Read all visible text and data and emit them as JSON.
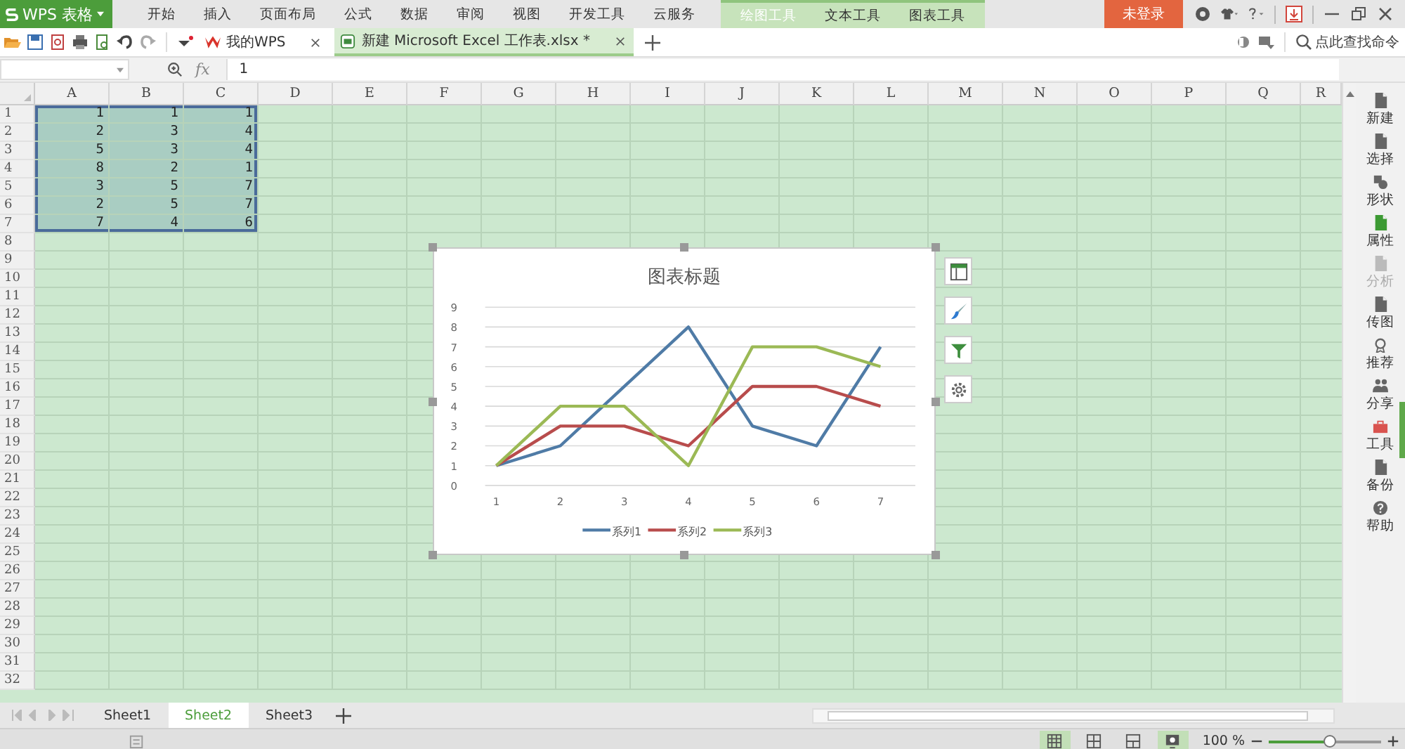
{
  "app": {
    "logo": "WPS 表格"
  },
  "menu_tabs": [
    {
      "label": "开始",
      "selected": false
    },
    {
      "label": "插入",
      "selected": false
    },
    {
      "label": "页面布局",
      "selected": false
    },
    {
      "label": "公式",
      "selected": false
    },
    {
      "label": "数据",
      "selected": false
    },
    {
      "label": "审阅",
      "selected": false
    },
    {
      "label": "视图",
      "selected": false
    },
    {
      "label": "开发工具",
      "selected": false
    },
    {
      "label": "云服务",
      "selected": false
    }
  ],
  "context_tabs": [
    {
      "label": "绘图工具",
      "selected": true
    },
    {
      "label": "文本工具",
      "selected": false
    },
    {
      "label": "图表工具",
      "selected": false
    }
  ],
  "login_button": "未登录",
  "doc_tabs": [
    {
      "label": "我的WPS",
      "selected": false
    },
    {
      "label": "新建 Microsoft Excel 工作表.xlsx *",
      "selected": true
    }
  ],
  "command_search": {
    "placeholder": "点此查找命令"
  },
  "formula_bar": {
    "fx": "fx",
    "value": "1"
  },
  "columns": [
    "A",
    "B",
    "C",
    "D",
    "E",
    "F",
    "G",
    "H",
    "I",
    "J",
    "K",
    "L",
    "M",
    "N",
    "O",
    "P",
    "Q",
    "R"
  ],
  "rows": [
    {
      "label": "1",
      "cells": [
        {
          "value": "1",
          "selected": true
        },
        {
          "value": "1",
          "selected": true
        },
        {
          "value": "1",
          "selected": true
        }
      ]
    },
    {
      "label": "2",
      "cells": [
        {
          "value": "2",
          "selected": true
        },
        {
          "value": "3",
          "selected": true
        },
        {
          "value": "4",
          "selected": true
        }
      ]
    },
    {
      "label": "3",
      "cells": [
        {
          "value": "5",
          "selected": true
        },
        {
          "value": "3",
          "selected": true
        },
        {
          "value": "4",
          "selected": true
        }
      ]
    },
    {
      "label": "4",
      "cells": [
        {
          "value": "8",
          "selected": true
        },
        {
          "value": "2",
          "selected": true
        },
        {
          "value": "1",
          "selected": true
        }
      ]
    },
    {
      "label": "5",
      "cells": [
        {
          "value": "3",
          "selected": true
        },
        {
          "value": "5",
          "selected": true
        },
        {
          "value": "7",
          "selected": true
        }
      ]
    },
    {
      "label": "6",
      "cells": [
        {
          "value": "2",
          "selected": true
        },
        {
          "value": "5",
          "selected": true
        },
        {
          "value": "7",
          "selected": true
        }
      ]
    },
    {
      "label": "7",
      "cells": [
        {
          "value": "7",
          "selected": true
        },
        {
          "value": "4",
          "selected": true
        },
        {
          "value": "6",
          "selected": true
        }
      ]
    },
    {
      "label": "8"
    },
    {
      "label": "9"
    },
    {
      "label": "10"
    },
    {
      "label": "11"
    },
    {
      "label": "12"
    },
    {
      "label": "13"
    },
    {
      "label": "14"
    },
    {
      "label": "15"
    },
    {
      "label": "16"
    },
    {
      "label": "17"
    },
    {
      "label": "18"
    },
    {
      "label": "19"
    },
    {
      "label": "20"
    },
    {
      "label": "21"
    },
    {
      "label": "22"
    },
    {
      "label": "23"
    },
    {
      "label": "24"
    },
    {
      "label": "25"
    },
    {
      "label": "26"
    },
    {
      "label": "27"
    },
    {
      "label": "28"
    },
    {
      "label": "29"
    },
    {
      "label": "30"
    },
    {
      "label": "31"
    },
    {
      "label": "32"
    }
  ],
  "chart": {
    "chart_data": {
      "type": "line",
      "title": "图表标题",
      "grid": true,
      "legend": true,
      "categories": [
        "1",
        "2",
        "3",
        "4",
        "5",
        "6",
        "7"
      ],
      "ylim": [
        0,
        9
      ],
      "yticks": [
        0,
        1,
        2,
        3,
        4,
        5,
        6,
        7,
        8,
        9
      ],
      "series": [
        {
          "name": "系列1",
          "color": "#4f7ba6",
          "values": [
            1,
            2,
            5,
            8,
            3,
            2,
            7
          ]
        },
        {
          "name": "系列2",
          "color": "#b84c4c",
          "values": [
            1,
            3,
            3,
            2,
            5,
            5,
            4
          ]
        },
        {
          "name": "系列3",
          "color": "#9bb955",
          "values": [
            1,
            4,
            4,
            1,
            7,
            7,
            6
          ]
        }
      ]
    }
  },
  "sidebar": [
    {
      "label": "新建",
      "disabled": false,
      "selected": false
    },
    {
      "label": "选择",
      "disabled": false,
      "selected": false
    },
    {
      "label": "形状",
      "disabled": false,
      "selected": false
    },
    {
      "label": "属性",
      "disabled": false,
      "selected": true
    },
    {
      "label": "分析",
      "disabled": true,
      "selected": false
    },
    {
      "label": "传图",
      "disabled": false,
      "selected": false
    },
    {
      "label": "推荐",
      "disabled": false,
      "selected": false
    },
    {
      "label": "分享",
      "disabled": false,
      "selected": false
    },
    {
      "label": "工具",
      "disabled": false,
      "selected": false
    },
    {
      "label": "备份",
      "disabled": false,
      "selected": false
    },
    {
      "label": "帮助",
      "disabled": false,
      "selected": false
    }
  ],
  "sheet_tabs": [
    {
      "label": "Sheet1",
      "selected": false
    },
    {
      "label": "Sheet2",
      "selected": true
    },
    {
      "label": "Sheet3",
      "selected": false
    }
  ],
  "status_bar": {
    "view_modes": [
      {
        "selected": true
      },
      {
        "selected": false
      },
      {
        "selected": false
      }
    ],
    "eye_care": {
      "on": true
    },
    "zoom": "100 %",
    "zoom_slider": {
      "level": 0.55
    }
  }
}
